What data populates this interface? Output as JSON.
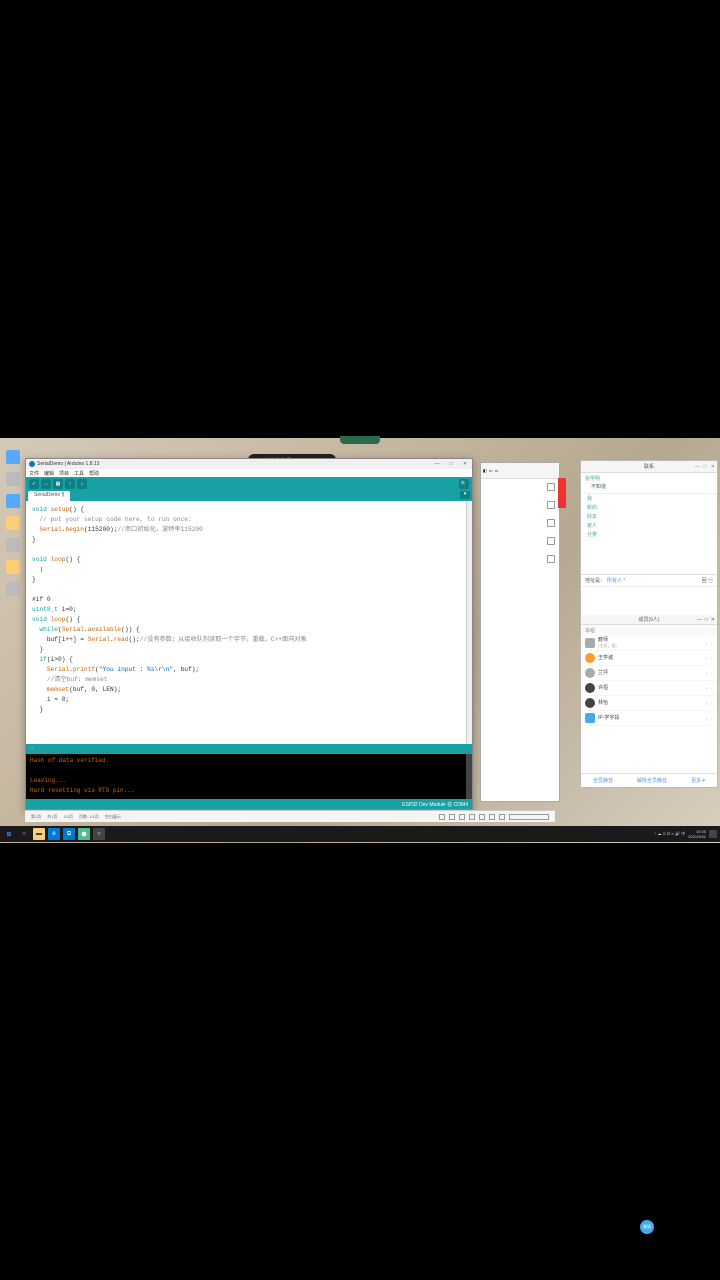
{
  "notch": "",
  "rec_pill": "正在讲话 教师",
  "arduino": {
    "title": "SerialDemo | Arduino 1.8.13",
    "menu": [
      "文件",
      "编辑",
      "项目",
      "工具",
      "帮助"
    ],
    "tab": "SerialDemo §",
    "code_lines": {
      "l1a": "void",
      "l1b": " setup",
      "l1c": "() {",
      "l2": "  // put your setup code here, to run once:",
      "l3a": "  Serial",
      "l3b": ".",
      "l3c": "begin",
      "l3d": "(115200);",
      "l3e": "//串口初始化，波特率115200",
      "l4": "}",
      "l5": "",
      "l6a": "void",
      "l6b": " loop",
      "l6c": "() {",
      "l7": "  |",
      "l8": "}",
      "l9": "",
      "l10": "#if 0",
      "l11a": "uint8_t",
      "l11b": " i=0;",
      "l12a": "void",
      "l12b": " loop",
      "l12c": "() {",
      "l13a": "  while",
      "l13b": "(",
      "l13c": "Serial",
      "l13d": ".",
      "l13e": "available",
      "l13f": "()) {",
      "l14a": "    buf[i++] = ",
      "l14b": "Serial",
      "l14c": ".",
      "l14d": "read",
      "l14e": "();",
      "l14f": "//没有参数；从接收队列读取一个字节，重载，C++面向对象",
      "l15": "  }",
      "l16a": "  if",
      "l16b": "(i>0) {",
      "l17a": "    Serial",
      "l17b": ".",
      "l17c": "printf",
      "l17d": "(",
      "l17e": "\"You input : %s\\r\\n\"",
      "l17f": ", buf);",
      "l18": "    //清空buf: memset",
      "l19a": "    memset",
      "l19b": "(buf, 0, LEN);",
      "l20": "    i = 0;",
      "l21": "  }"
    },
    "console_header": "...",
    "console": {
      "c1": "Hash of data verified.",
      "c2": "",
      "c3": "Leaving...",
      "c4": "Hard resetting via RTS pin..."
    },
    "status_right": "ESP32 Dev Module 在 COM4"
  },
  "chat": {
    "title": "联系",
    "section1": "张学明",
    "section1_sub": "不知道",
    "cats": [
      "我",
      "新的",
      "好友",
      "家人",
      "分类"
    ],
    "addr_label": "地址是：",
    "addr_link": "所有人 *",
    "addr_icons": "回 ㊀",
    "mid_bar": "成员(9人)",
    "group": "本组",
    "contacts": [
      {
        "name": "教师",
        "sub": "(主机，我)",
        "avatarCls": "sq grey",
        "right": "♀ ⋮"
      },
      {
        "name": "王学诚",
        "sub": "",
        "avatarCls": "orange",
        "right": "♀ ⋮"
      },
      {
        "name": "兰坪",
        "sub": "",
        "avatarCls": "grey",
        "right": "♀ ⋮"
      },
      {
        "name": "许恒",
        "sub": "",
        "avatarCls": "dark",
        "right": "♀ ⋮"
      },
      {
        "name": "林怡",
        "sub": "",
        "avatarCls": "dark",
        "right": "♀ ⋮"
      },
      {
        "name": "IP-学字段",
        "sub": "",
        "avatarCls": "sq blue",
        "right": "♀ ⋮"
      }
    ],
    "bottom": [
      "全员静音",
      "解除全员静音",
      "更多 ▾"
    ]
  },
  "circle": "邀请",
  "app_bottom": {
    "items": [
      "第1页",
      "共1页",
      "1/1页",
      "页",
      "1/1",
      "页数: 1/1页",
      "行",
      "空白展示"
    ]
  },
  "taskbar": {
    "tray": "^ ☁ G ⏻ ∞ 🔊 中",
    "time": "19:35",
    "date": "2021/3/31"
  }
}
